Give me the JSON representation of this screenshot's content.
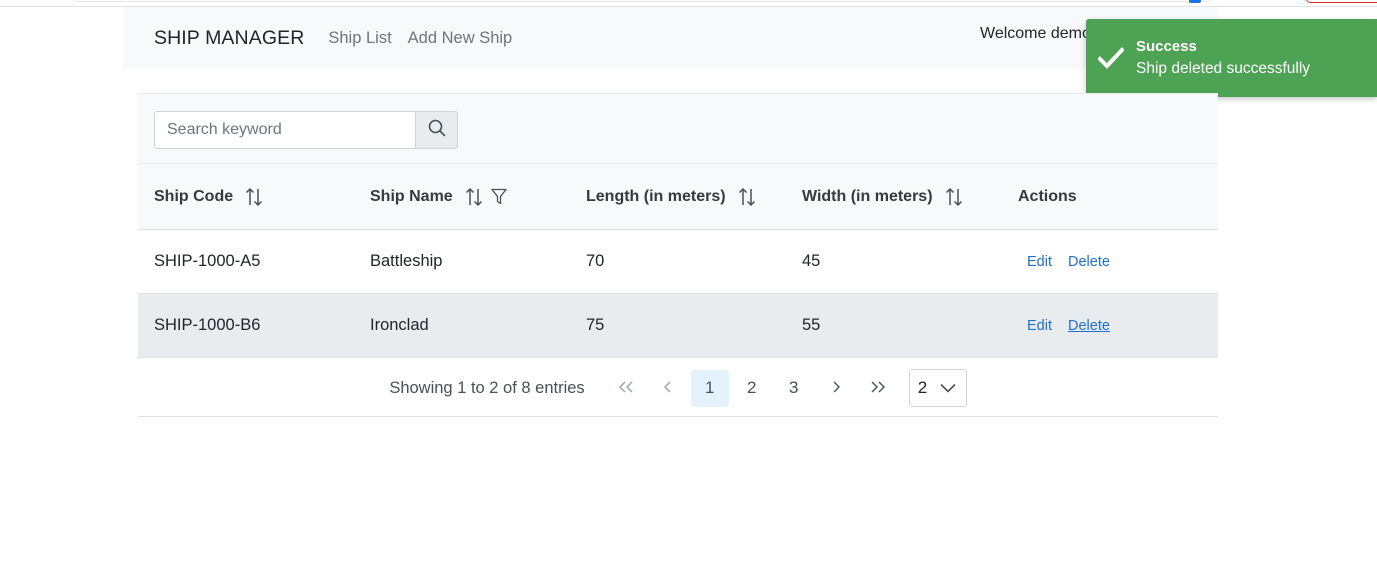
{
  "header": {
    "brand": "SHIP MANAGER",
    "links": [
      "Ship List",
      "Add New Ship"
    ],
    "welcome": "Welcome demo"
  },
  "toast": {
    "title": "Success",
    "message": "Ship deleted successfully",
    "color": "#4ea254"
  },
  "search": {
    "placeholder": "Search keyword"
  },
  "table": {
    "columns": [
      "Ship Code",
      "Ship Name",
      "Length (in meters)",
      "Width (in meters)",
      "Actions"
    ],
    "rows": [
      {
        "code": "SHIP-1000-A5",
        "name": "Battleship",
        "length": "70",
        "width": "45"
      },
      {
        "code": "SHIP-1000-B6",
        "name": "Ironclad",
        "length": "75",
        "width": "55"
      }
    ],
    "edit_label": "Edit",
    "delete_label": "Delete"
  },
  "pagination": {
    "report": "Showing 1 to 2 of 8 entries",
    "pages": [
      "1",
      "2",
      "3"
    ],
    "current_page": "1",
    "rows_per_page": "2"
  },
  "icons": {
    "search": "search-icon",
    "sort": "sort-icon",
    "filter": "filter-icon",
    "check": "check-icon",
    "first": "first-page-icon",
    "prev": "prev-page-icon",
    "next": "next-page-icon",
    "last": "last-page-icon",
    "dropdown": "chevron-down-icon"
  }
}
